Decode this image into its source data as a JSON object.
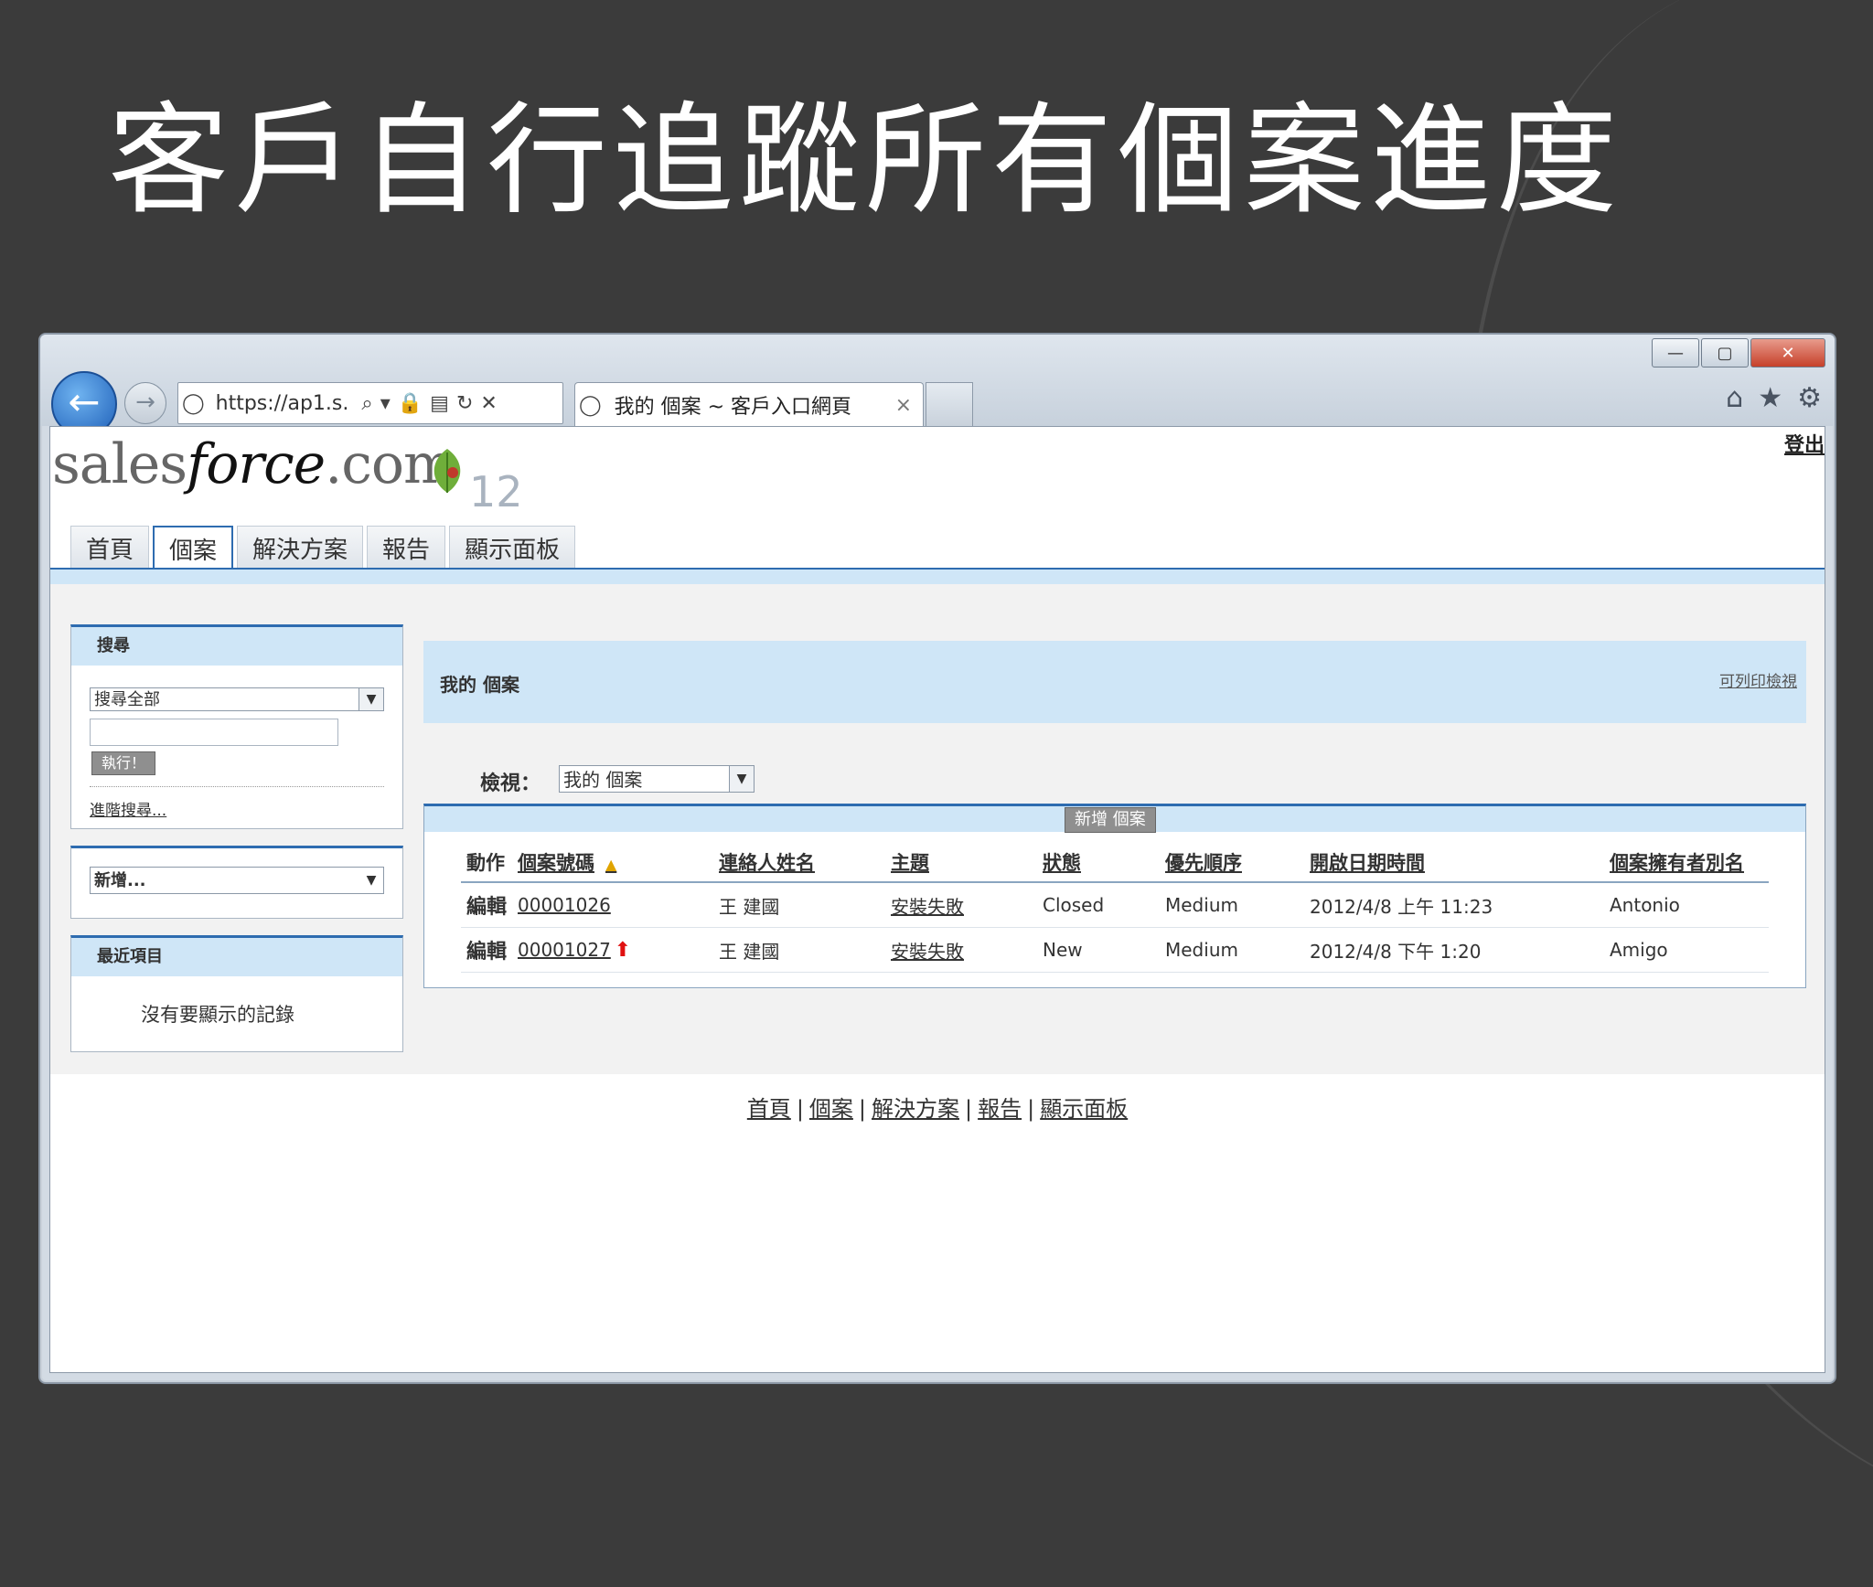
{
  "slide": {
    "title": "客戶自行追蹤所有個案進度"
  },
  "browser": {
    "address_url": "https://ap1.s.",
    "tab_title": "我的 個案 ~ 客戶入口網頁",
    "tab_close": "×",
    "back_glyph": "←",
    "forward_glyph": "→",
    "window_controls": [
      "—",
      "▢",
      "✕"
    ],
    "tool_icons": [
      "home-icon",
      "star-icon",
      "gear-icon"
    ]
  },
  "header": {
    "logout": "登出",
    "logo_text_a": "sales",
    "logo_text_b": "force",
    "logo_text_c": ".com",
    "logo_version": "12"
  },
  "tabs": [
    "首頁",
    "個案",
    "解決方案",
    "報告",
    "顯示面板"
  ],
  "sidebar": {
    "search": {
      "title": "搜尋",
      "scope_selected": "搜尋全部",
      "exec_button": "執行！",
      "advanced_link": "進階搜尋..."
    },
    "create_new": {
      "selected": "新增..."
    },
    "recent": {
      "title": "最近項目",
      "empty_text": "沒有要顯示的記錄"
    }
  },
  "main": {
    "title": "我的 個案",
    "print_link": "可列印檢視",
    "view_label": "檢視：",
    "view_selected": "我的 個案",
    "new_case_button": "新增 個案",
    "columns": [
      "動作",
      "個案號碼",
      "連絡人姓名",
      "主題",
      "狀態",
      "優先順序",
      "開啟日期時間",
      "個案擁有者別名"
    ],
    "rows": [
      {
        "action": "編輯",
        "case_number": "00001026",
        "contact": "王 建國",
        "subject": "安裝失敗",
        "status": "Closed",
        "priority": "Medium",
        "opened": "2012/4/8 上午 11:23",
        "owner": "Antonio"
      },
      {
        "action": "編輯",
        "case_number": "00001027",
        "contact": "王 建國",
        "subject": "安裝失敗",
        "status": "New",
        "priority": "Medium",
        "opened": "2012/4/8 下午 1:20",
        "owner": "Amigo"
      }
    ]
  },
  "footer": {
    "links": [
      "首頁",
      "個案",
      "解決方案",
      "報告",
      "顯示面板"
    ],
    "separator": "|"
  },
  "colors": {
    "accent_blue": "#2e6cb0",
    "panel_blue": "#cfe6f7",
    "slide_bg": "#3b3b3b"
  }
}
